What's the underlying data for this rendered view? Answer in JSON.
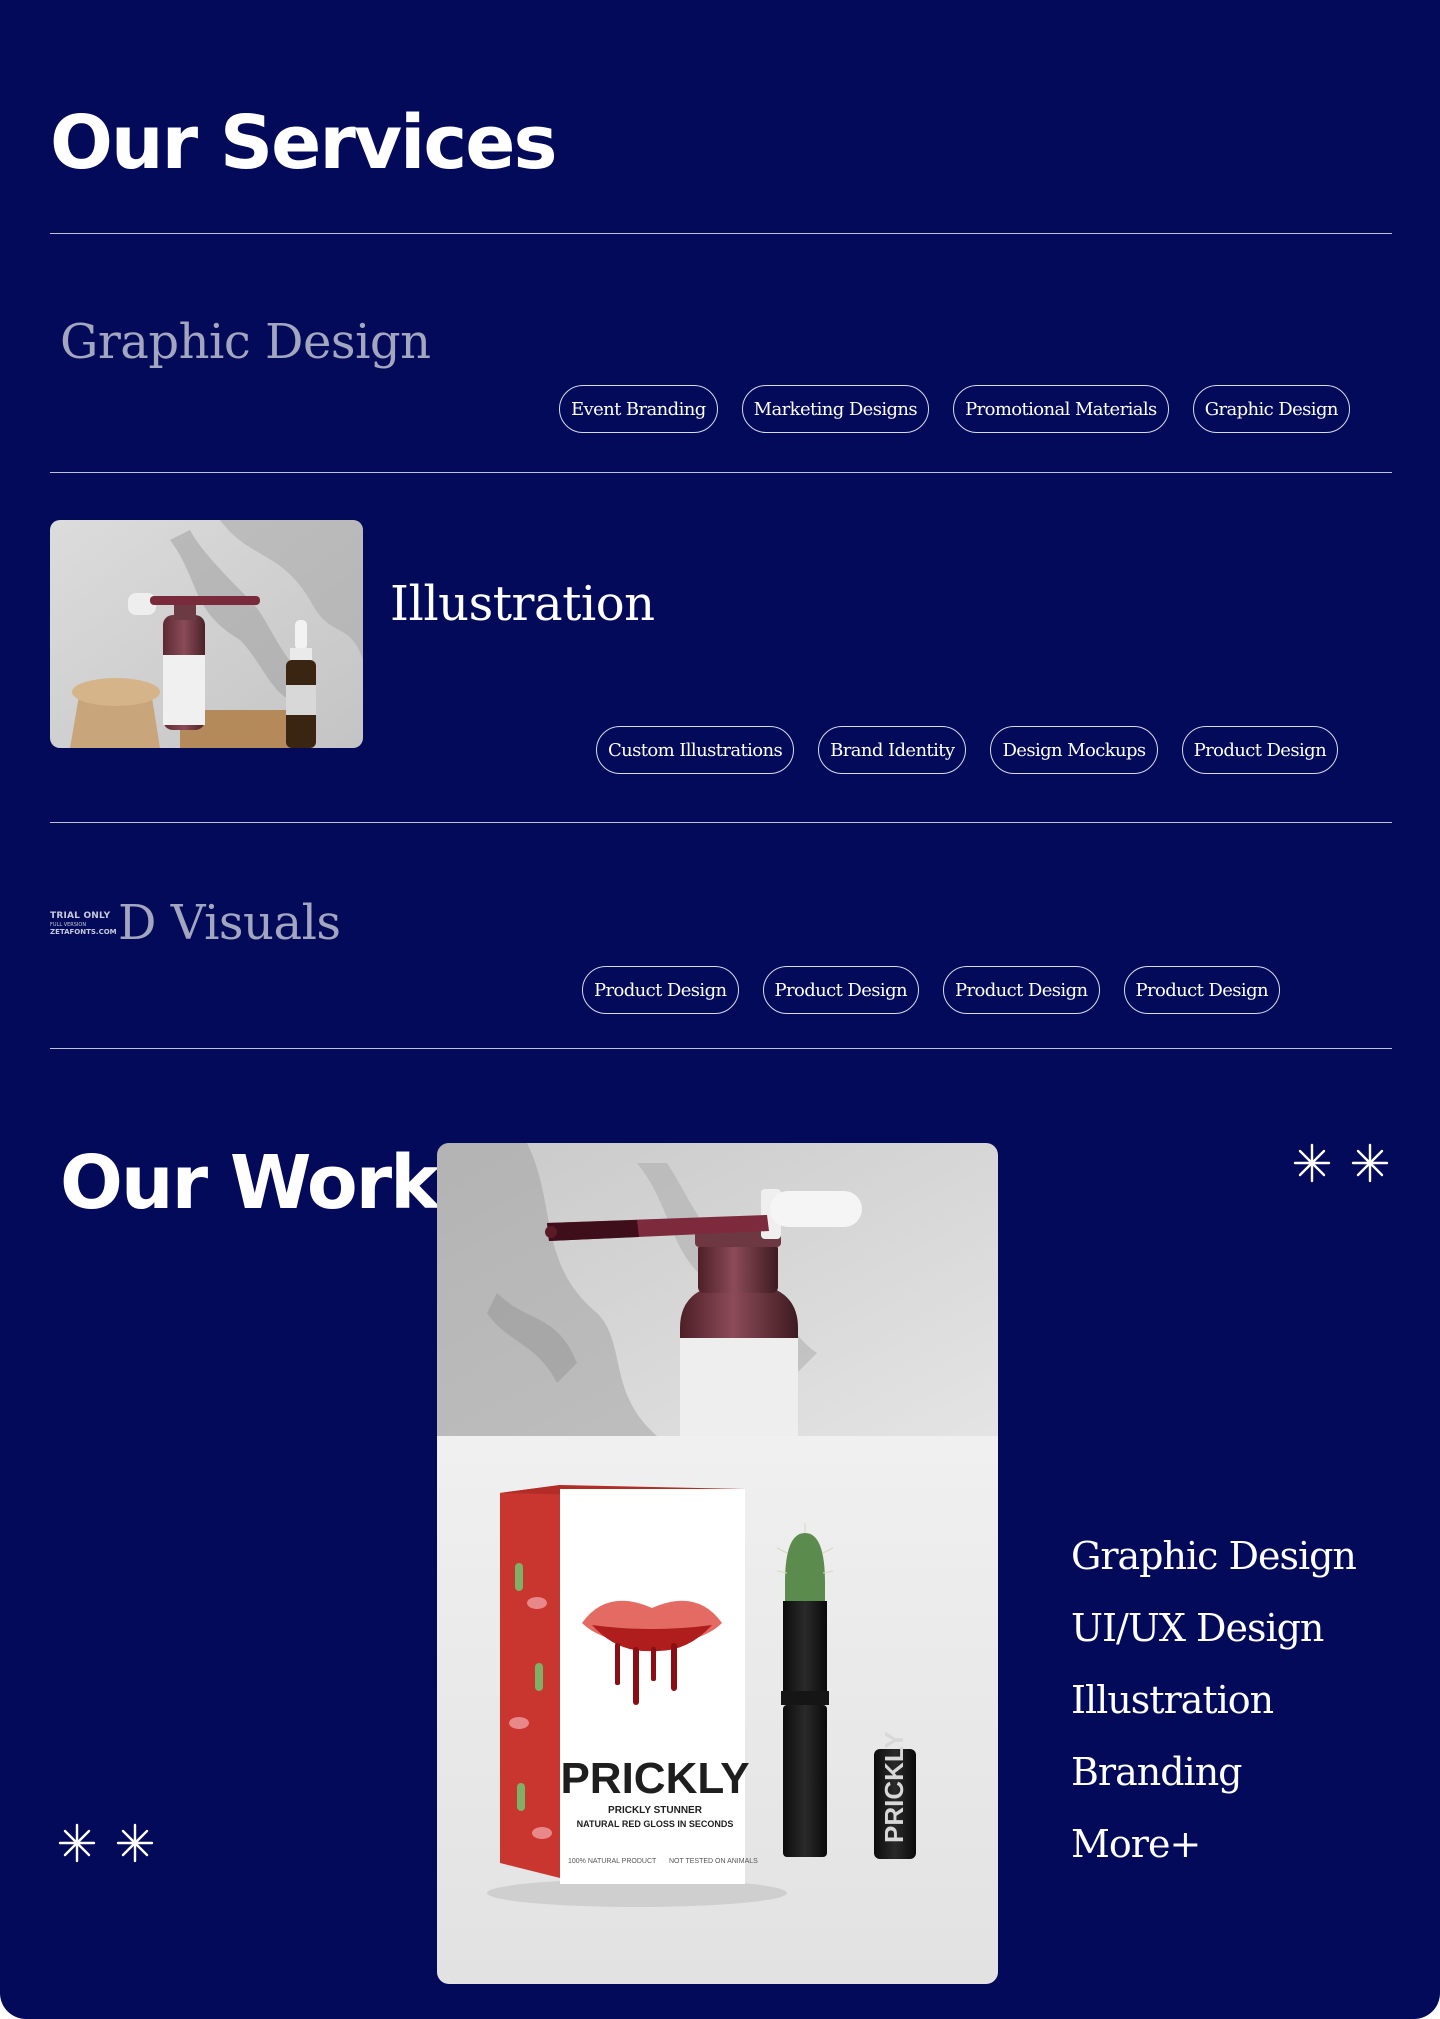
{
  "services": {
    "heading": "Our Services",
    "items": [
      {
        "title": "Graphic Design",
        "tags": [
          "Event Branding",
          "Marketing Designs",
          "Promotional Materials",
          "Graphic Design"
        ]
      },
      {
        "title": "Illustration",
        "tags": [
          "Custom Illustrations",
          "Brand Identity",
          "Design Mockups",
          "Product Design"
        ]
      },
      {
        "title": "D Visuals",
        "watermark": [
          "TRIAL ONLY",
          "FULL VERSION",
          "ZETAFONTS.COM"
        ],
        "tags": [
          "Product Design",
          "Product Design",
          "Product Design",
          "Product Design"
        ]
      }
    ]
  },
  "work": {
    "heading": "Our Work",
    "categories": [
      "Graphic Design",
      "UI/UX Design",
      "Illustration",
      "Branding",
      "More+"
    ],
    "packaging": {
      "brand": "PRICKLY",
      "subtitle": "PRICKLY STUNNER",
      "tagline": "NATURAL RED GLOSS IN SECONDS",
      "left_note": "100% NATURAL PRODUCT",
      "right_note": "NOT TESTED ON ANIMALS",
      "tube_label": "PRICKLY"
    }
  },
  "colors": {
    "background": "#030a5a",
    "text": "#ffffff",
    "muted": "#a3a6bf",
    "border": "#d8dbea"
  }
}
